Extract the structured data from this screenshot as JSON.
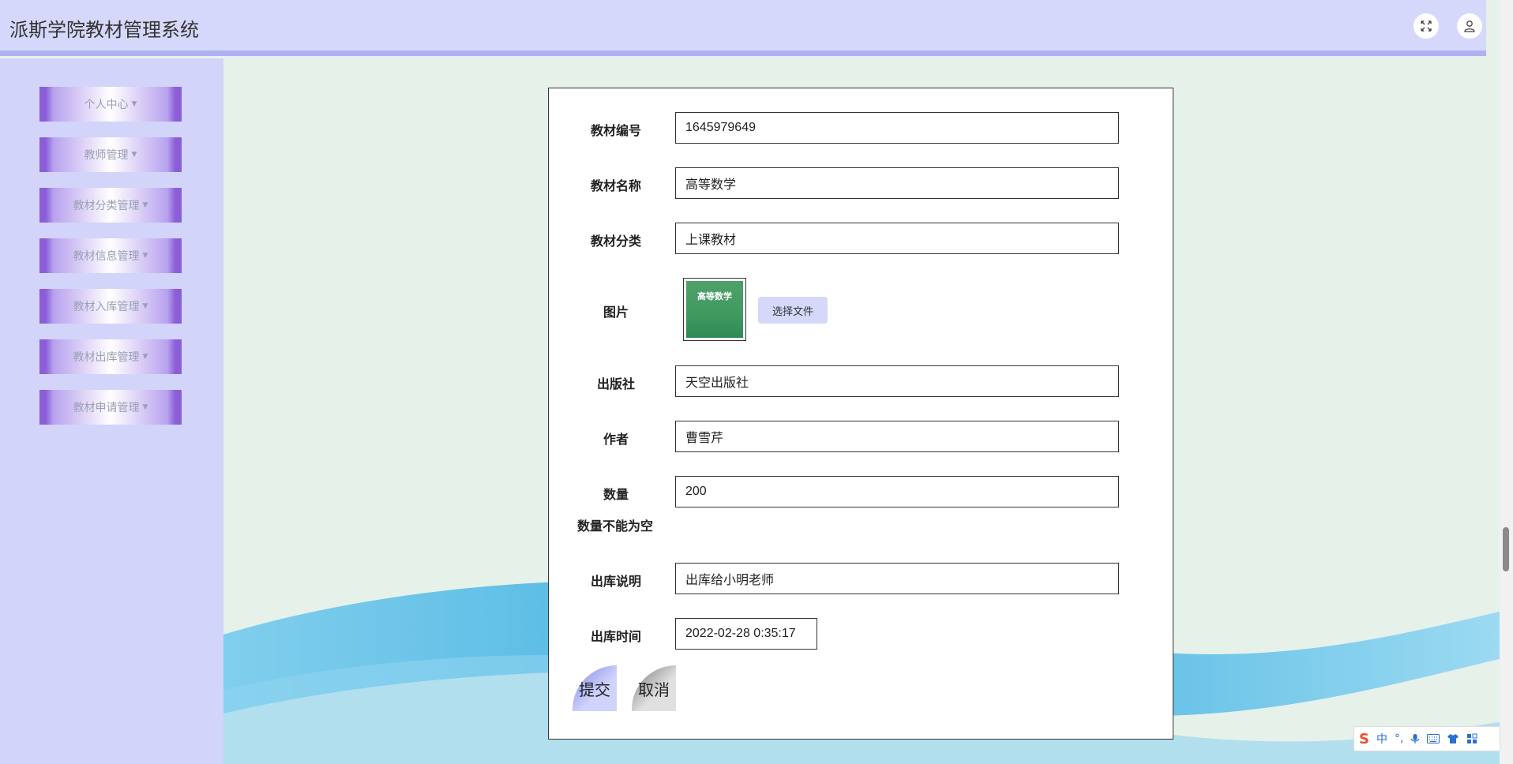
{
  "app": {
    "title": "派斯学院教材管理系统"
  },
  "header": {
    "fullscreen_icon": "fullscreen-icon",
    "user_icon": "user-icon"
  },
  "sidebar": {
    "items": [
      {
        "label": "个人中心"
      },
      {
        "label": "教师管理"
      },
      {
        "label": "教材分类管理"
      },
      {
        "label": "教材信息管理"
      },
      {
        "label": "教材入库管理"
      },
      {
        "label": "教材出库管理"
      },
      {
        "label": "教材申请管理"
      }
    ]
  },
  "form": {
    "fields": {
      "code": {
        "label": "教材编号",
        "value": "1645979649"
      },
      "name": {
        "label": "教材名称",
        "value": "高等数学"
      },
      "category": {
        "label": "教材分类",
        "value": "上课教材"
      },
      "image": {
        "label": "图片",
        "choose_file": "选择文件",
        "cover_title": "高等数学"
      },
      "publisher": {
        "label": "出版社",
        "value": "天空出版社"
      },
      "author": {
        "label": "作者",
        "value": "曹雪芹"
      },
      "quantity": {
        "label": "数量",
        "value": "200",
        "error": "数量不能为空"
      },
      "outbound_note": {
        "label": "出库说明",
        "value": "出库给小明老师"
      },
      "outbound_time": {
        "label": "出库时间",
        "value": "2022-02-28 0:35:17"
      }
    },
    "submit_label": "提交",
    "cancel_label": "取消"
  },
  "ime": {
    "logo": "S",
    "mode": "中",
    "punct": "°,",
    "icons": [
      "microphone-icon",
      "keyboard-icon",
      "shirt-icon",
      "grid-icon"
    ]
  },
  "colors": {
    "header_bg": "#d6d8fb",
    "sidebar_bg": "#d2d4fa",
    "menu_accent": "#8b5ed8",
    "page_bg": "#e6f1ea",
    "submit_btn": "#7d84e2"
  }
}
